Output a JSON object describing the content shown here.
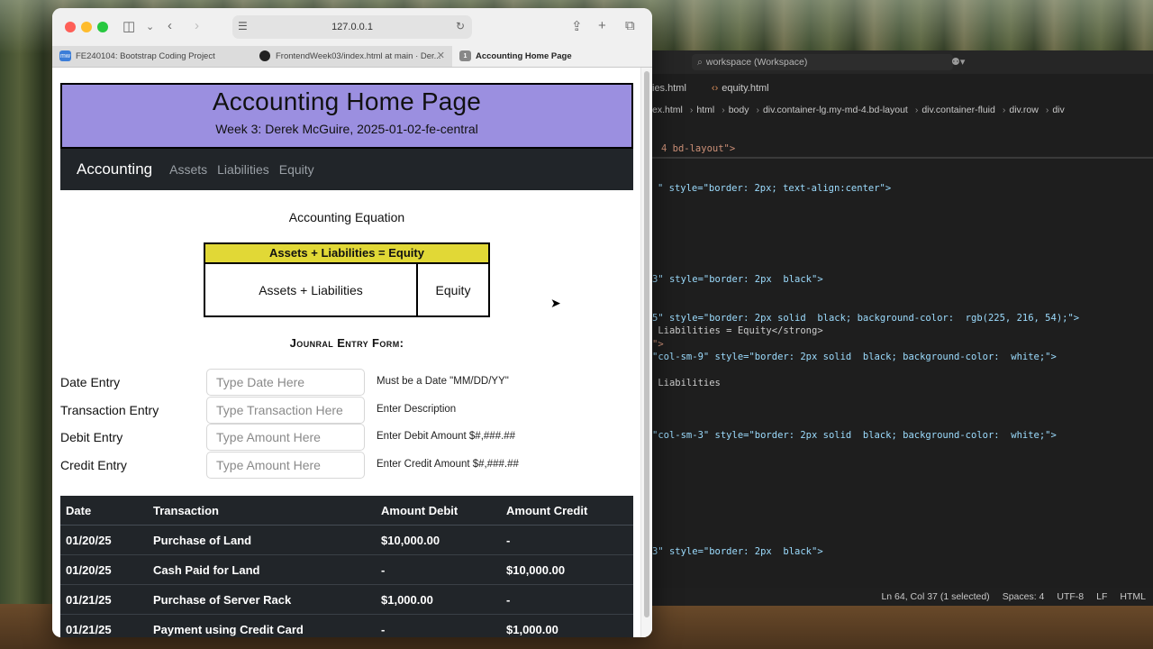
{
  "browser": {
    "url": "127.0.0.1",
    "tabs": [
      {
        "label": "FE240104: Bootstrap Coding Project",
        "favicon": "mw"
      },
      {
        "label": "FrontendWeek03/index.html at main · Der...",
        "favicon": "github"
      },
      {
        "label": "Accounting Home Page",
        "favicon": "1",
        "active": true
      }
    ]
  },
  "page": {
    "header": {
      "title": "Accounting Home Page",
      "subtitle": "Week 3: Derek McGuire, 2025-01-02-fe-central",
      "bg_color": "#9b8fe0"
    },
    "navbar": {
      "brand": "Accounting",
      "links": [
        "Assets",
        "Liabilities",
        "Equity"
      ]
    },
    "equation": {
      "title": "Accounting Equation",
      "header": "Assets + Liabilities = Equity",
      "left": "Assets + Liabilities",
      "right": "Equity",
      "header_color": "#e1d836"
    },
    "form": {
      "title": "Jounral Entry Form:",
      "rows": [
        {
          "label": "Date Entry",
          "placeholder": "Type Date Here",
          "help": "Must be a Date \"MM/DD/YY\""
        },
        {
          "label": "Transaction Entry",
          "placeholder": "Type Transaction Here",
          "help": "Enter Description"
        },
        {
          "label": "Debit Entry",
          "placeholder": "Type Amount Here",
          "help": "Enter Debit Amount $#,###.##"
        },
        {
          "label": "Credit Entry",
          "placeholder": "Type Amount Here",
          "help": "Enter Credit Amount $#,###.##"
        }
      ]
    },
    "ledger": {
      "headers": [
        "Date",
        "Transaction",
        "Amount Debit",
        "Amount Credit"
      ],
      "rows": [
        [
          "01/20/25",
          "Purchase of Land",
          "$10,000.00",
          "-"
        ],
        [
          "01/20/25",
          "Cash Paid for Land",
          "-",
          "$10,000.00"
        ],
        [
          "01/21/25",
          "Purchase of Server Rack",
          "$1,000.00",
          "-"
        ],
        [
          "01/21/25",
          "Payment using Credit Card",
          "-",
          "$1,000.00"
        ]
      ]
    }
  },
  "editor": {
    "search": "workspace (Workspace)",
    "tabs": [
      "ies.html",
      "equity.html"
    ],
    "breadcrumbs": [
      "ex.html",
      "html",
      "body",
      "div.container-lg.my-md-4.bd-layout",
      "div.container-fluid",
      "div.row",
      "div"
    ],
    "code": [
      "4 bd-layout\">",
      "\" style=\"border: 2px; text-align:center\">",
      "3\" style=\"border: 2px  black\">",
      "5\" style=\"border: 2px solid  black; background-color:  rgb(225, 216, 54);\">",
      " Liabilities = Equity</strong>",
      "\">",
      "\"col-sm-9\" style=\"border: 2px solid  black; background-color:  white;\">",
      " Liabilities",
      "\"col-sm-3\" style=\"border: 2px solid  black; background-color:  white;\">",
      "3\" style=\"border: 2px  black\">"
    ],
    "status": [
      "Ln 64, Col 37 (1 selected)",
      "Spaces: 4",
      "UTF-8",
      "LF",
      "HTML"
    ]
  }
}
